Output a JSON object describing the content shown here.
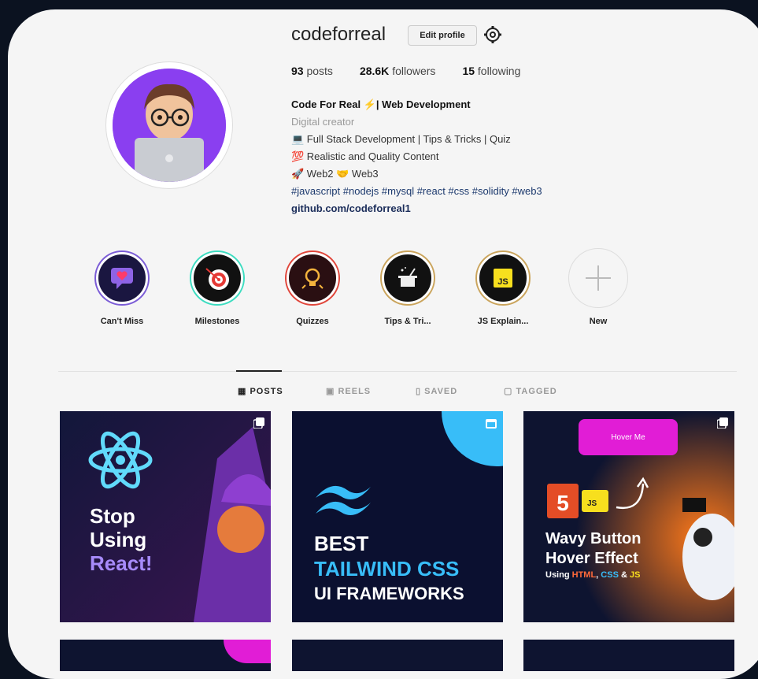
{
  "profile": {
    "username": "codeforreal",
    "edit_label": "Edit profile",
    "stats": {
      "posts_count": "93",
      "posts_label": "posts",
      "followers_count": "28.6K",
      "followers_label": "followers",
      "following_count": "15",
      "following_label": "following"
    },
    "bio": {
      "name": "Code For Real ⚡| Web Development",
      "category": "Digital creator",
      "line1": "💻 Full Stack Development | Tips & Tricks | Quiz",
      "line2": "💯 Realistic and Quality Content",
      "line3": "🚀 Web2 🤝 Web3",
      "hashtags": "#javascript #nodejs #mysql #react #css #solidity #web3",
      "link": "github.com/codeforreal1"
    }
  },
  "highlights": [
    {
      "label": "Can't Miss"
    },
    {
      "label": "Milestones"
    },
    {
      "label": "Quizzes"
    },
    {
      "label": "Tips & Tri..."
    },
    {
      "label": "JS Explain..."
    },
    {
      "label": "New"
    }
  ],
  "tabs": {
    "posts": "POSTS",
    "reels": "REELS",
    "saved": "SAVED",
    "tagged": "TAGGED"
  },
  "posts": [
    {
      "line1": "Stop",
      "line2": "Using",
      "line3": "React!"
    },
    {
      "line1": "BEST",
      "line2": "TAILWIND CSS",
      "line3": "UI FRAMEWORKS"
    },
    {
      "button": "Hover Me",
      "line1": "Wavy Button",
      "line2": "Hover Effect",
      "line3_a": "Using ",
      "line3_html": "HTML",
      "line3_b": ", ",
      "line3_css": "CSS",
      "line3_c": " & ",
      "line3_js": "JS",
      "badge": "JS"
    }
  ],
  "colors": {
    "accent_purple": "#8a3ff0",
    "react_cyan": "#61dafb",
    "tailwind_cyan": "#38bdf8",
    "hover_pink": "#e11dd6",
    "post_bg": "#0e1430"
  }
}
